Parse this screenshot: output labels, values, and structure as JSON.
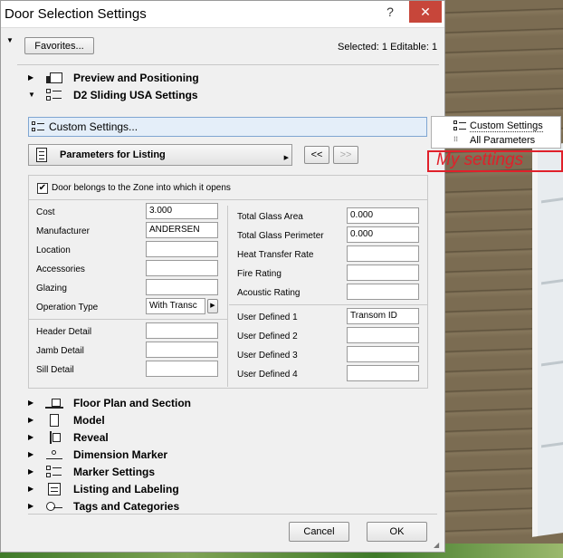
{
  "window": {
    "title": "Door Selection Settings",
    "help_glyph": "?",
    "close_glyph": "✕"
  },
  "header": {
    "favorites_label": "Favorites...",
    "status": "Selected: 1 Editable: 1"
  },
  "sections_top": [
    {
      "label": "Preview and Positioning",
      "expanded": false
    },
    {
      "label": "D2 Sliding USA Settings",
      "expanded": true
    }
  ],
  "custom_settings": {
    "label": "Custom Settings..."
  },
  "listing": {
    "label": "Parameters for Listing",
    "prev_label": "<<",
    "next_label": ">>"
  },
  "zone_checkbox": {
    "label": "Door belongs to the Zone into which it opens",
    "checked": true,
    "mark": "✔"
  },
  "left_fields": [
    {
      "label": "Cost",
      "value": "3.000"
    },
    {
      "label": "Manufacturer",
      "value": "ANDERSEN"
    },
    {
      "label": "Location",
      "value": ""
    },
    {
      "label": "Accessories",
      "value": ""
    },
    {
      "label": "Glazing",
      "value": ""
    },
    {
      "label": "Operation Type",
      "value": "With Transc"
    },
    {
      "label": "Header Detail",
      "value": ""
    },
    {
      "label": "Jamb Detail",
      "value": ""
    },
    {
      "label": "Sill Detail",
      "value": ""
    }
  ],
  "right_fields": [
    {
      "label": "Total Glass Area",
      "value": "0.000"
    },
    {
      "label": "Total Glass Perimeter",
      "value": "0.000"
    },
    {
      "label": "Heat Transfer Rate",
      "value": ""
    },
    {
      "label": "Fire Rating",
      "value": ""
    },
    {
      "label": "Acoustic Rating",
      "value": ""
    },
    {
      "label": "User Defined 1",
      "value": "Transom ID"
    },
    {
      "label": "User Defined 2",
      "value": ""
    },
    {
      "label": "User Defined 3",
      "value": ""
    },
    {
      "label": "User Defined 4",
      "value": ""
    }
  ],
  "sections_bottom": [
    {
      "label": "Floor Plan and Section"
    },
    {
      "label": "Model"
    },
    {
      "label": "Reveal"
    },
    {
      "label": "Dimension Marker"
    },
    {
      "label": "Marker Settings"
    },
    {
      "label": "Listing and Labeling"
    },
    {
      "label": "Tags and Categories"
    }
  ],
  "footer": {
    "cancel_label": "Cancel",
    "ok_label": "OK"
  },
  "popup": {
    "items": [
      "Custom Settings",
      "All Parameters"
    ]
  },
  "annotation": {
    "text": "My settings",
    "color": "#e0202a"
  },
  "glyphs": {
    "collapsed": "▶",
    "expanded": "▼",
    "menu_arrow": "▶"
  }
}
